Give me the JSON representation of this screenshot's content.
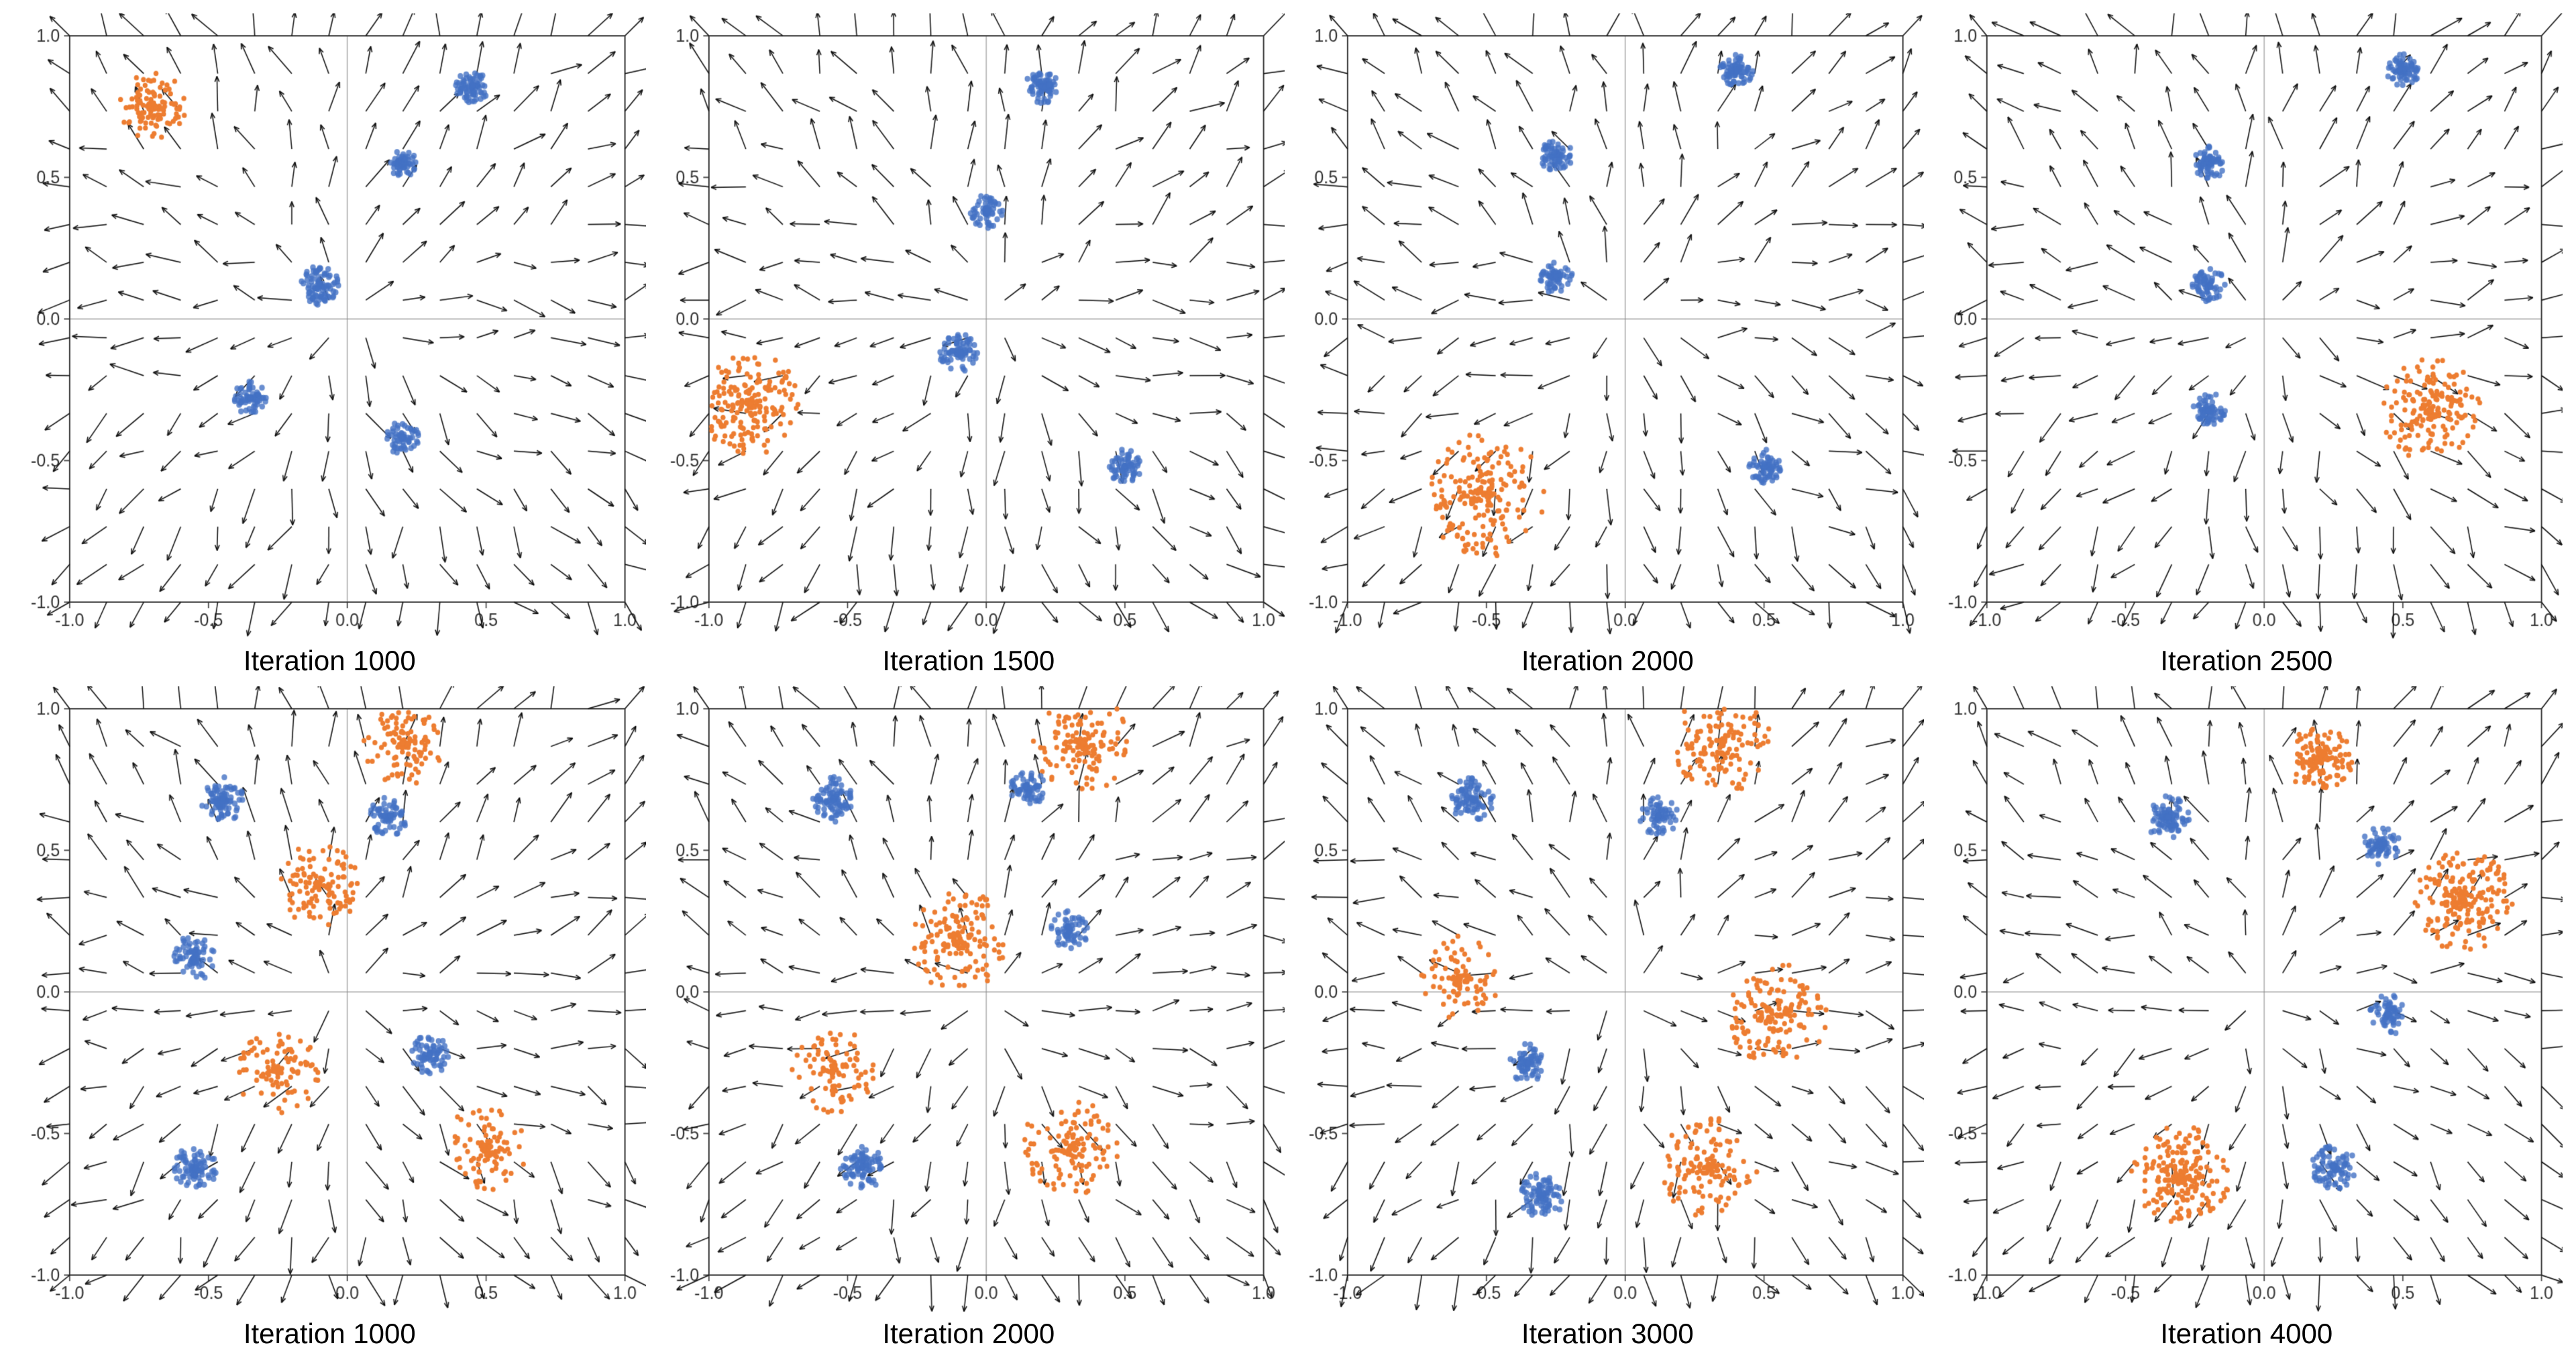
{
  "plots": [
    {
      "id": "p1",
      "title": "Iteration 1000",
      "row": 0,
      "col": 0,
      "blue_clusters": [
        {
          "cx": 0.45,
          "cy": 0.82,
          "spread": 0.06,
          "n": 80
        },
        {
          "cx": 0.2,
          "cy": 0.55,
          "spread": 0.05,
          "n": 60
        },
        {
          "cx": -0.1,
          "cy": 0.12,
          "spread": 0.07,
          "n": 90
        },
        {
          "cx": -0.35,
          "cy": -0.28,
          "spread": 0.06,
          "n": 70
        },
        {
          "cx": 0.2,
          "cy": -0.42,
          "spread": 0.06,
          "n": 65
        }
      ],
      "orange_clusters": [
        {
          "cx": -0.7,
          "cy": 0.75,
          "spread": 0.12,
          "n": 120
        }
      ],
      "has_field": true
    },
    {
      "id": "p2",
      "title": "Iteration 1500",
      "row": 0,
      "col": 1,
      "blue_clusters": [
        {
          "cx": 0.2,
          "cy": 0.82,
          "spread": 0.06,
          "n": 80
        },
        {
          "cx": -0.0,
          "cy": 0.38,
          "spread": 0.06,
          "n": 70
        },
        {
          "cx": -0.1,
          "cy": -0.12,
          "spread": 0.07,
          "n": 80
        },
        {
          "cx": 0.5,
          "cy": -0.52,
          "spread": 0.06,
          "n": 70
        }
      ],
      "orange_clusters": [
        {
          "cx": -0.85,
          "cy": -0.3,
          "spread": 0.18,
          "n": 200
        }
      ],
      "has_field": true
    },
    {
      "id": "p3",
      "title": "Iteration 2000",
      "row": 0,
      "col": 2,
      "blue_clusters": [
        {
          "cx": 0.4,
          "cy": 0.88,
          "spread": 0.06,
          "n": 80
        },
        {
          "cx": -0.25,
          "cy": 0.58,
          "spread": 0.06,
          "n": 70
        },
        {
          "cx": -0.25,
          "cy": 0.15,
          "spread": 0.06,
          "n": 70
        },
        {
          "cx": 0.5,
          "cy": -0.52,
          "spread": 0.06,
          "n": 70
        }
      ],
      "orange_clusters": [
        {
          "cx": -0.5,
          "cy": -0.62,
          "spread": 0.22,
          "n": 200
        }
      ],
      "has_field": true
    },
    {
      "id": "p4",
      "title": "Iteration 2500",
      "row": 0,
      "col": 3,
      "blue_clusters": [
        {
          "cx": 0.5,
          "cy": 0.88,
          "spread": 0.06,
          "n": 80
        },
        {
          "cx": -0.2,
          "cy": 0.55,
          "spread": 0.06,
          "n": 70
        },
        {
          "cx": -0.2,
          "cy": 0.12,
          "spread": 0.06,
          "n": 70
        },
        {
          "cx": -0.2,
          "cy": -0.32,
          "spread": 0.06,
          "n": 70
        }
      ],
      "orange_clusters": [
        {
          "cx": 0.6,
          "cy": -0.32,
          "spread": 0.18,
          "n": 180
        }
      ],
      "has_field": true
    },
    {
      "id": "p5",
      "title": "Iteration 1000",
      "row": 1,
      "col": 0,
      "blue_clusters": [
        {
          "cx": -0.45,
          "cy": 0.68,
          "spread": 0.08,
          "n": 90
        },
        {
          "cx": 0.15,
          "cy": 0.62,
          "spread": 0.07,
          "n": 70
        },
        {
          "cx": -0.55,
          "cy": 0.12,
          "spread": 0.08,
          "n": 80
        },
        {
          "cx": -0.55,
          "cy": -0.62,
          "spread": 0.08,
          "n": 90
        },
        {
          "cx": 0.3,
          "cy": -0.22,
          "spread": 0.07,
          "n": 70
        }
      ],
      "orange_clusters": [
        {
          "cx": 0.2,
          "cy": 0.88,
          "spread": 0.15,
          "n": 120
        },
        {
          "cx": -0.1,
          "cy": 0.38,
          "spread": 0.15,
          "n": 120
        },
        {
          "cx": 0.5,
          "cy": -0.55,
          "spread": 0.15,
          "n": 100
        },
        {
          "cx": -0.25,
          "cy": -0.28,
          "spread": 0.15,
          "n": 100
        }
      ],
      "has_field": true
    },
    {
      "id": "p6",
      "title": "Iteration 2000",
      "row": 1,
      "col": 1,
      "blue_clusters": [
        {
          "cx": -0.55,
          "cy": 0.68,
          "spread": 0.08,
          "n": 90
        },
        {
          "cx": 0.15,
          "cy": 0.72,
          "spread": 0.07,
          "n": 70
        },
        {
          "cx": 0.3,
          "cy": 0.22,
          "spread": 0.07,
          "n": 70
        },
        {
          "cx": -0.45,
          "cy": -0.62,
          "spread": 0.08,
          "n": 90
        }
      ],
      "orange_clusters": [
        {
          "cx": 0.35,
          "cy": 0.88,
          "spread": 0.18,
          "n": 150
        },
        {
          "cx": -0.1,
          "cy": 0.18,
          "spread": 0.18,
          "n": 150
        },
        {
          "cx": 0.3,
          "cy": -0.55,
          "spread": 0.18,
          "n": 130
        },
        {
          "cx": -0.55,
          "cy": -0.28,
          "spread": 0.15,
          "n": 100
        }
      ],
      "has_field": true
    },
    {
      "id": "p7",
      "title": "Iteration 3000",
      "row": 1,
      "col": 2,
      "blue_clusters": [
        {
          "cx": -0.55,
          "cy": 0.68,
          "spread": 0.08,
          "n": 90
        },
        {
          "cx": 0.12,
          "cy": 0.62,
          "spread": 0.07,
          "n": 70
        },
        {
          "cx": -0.35,
          "cy": -0.25,
          "spread": 0.07,
          "n": 70
        },
        {
          "cx": -0.3,
          "cy": -0.72,
          "spread": 0.08,
          "n": 90
        }
      ],
      "orange_clusters": [
        {
          "cx": 0.35,
          "cy": 0.88,
          "spread": 0.18,
          "n": 150
        },
        {
          "cx": 0.55,
          "cy": -0.08,
          "spread": 0.18,
          "n": 150
        },
        {
          "cx": 0.3,
          "cy": -0.62,
          "spread": 0.18,
          "n": 130
        },
        {
          "cx": -0.6,
          "cy": 0.05,
          "spread": 0.15,
          "n": 100
        }
      ],
      "has_field": true
    },
    {
      "id": "p8",
      "title": "Iteration 4000",
      "row": 1,
      "col": 3,
      "blue_clusters": [
        {
          "cx": -0.35,
          "cy": 0.62,
          "spread": 0.08,
          "n": 90
        },
        {
          "cx": 0.42,
          "cy": 0.52,
          "spread": 0.07,
          "n": 70
        },
        {
          "cx": 0.45,
          "cy": -0.08,
          "spread": 0.07,
          "n": 70
        },
        {
          "cx": 0.25,
          "cy": -0.62,
          "spread": 0.08,
          "n": 90
        }
      ],
      "orange_clusters": [
        {
          "cx": 0.2,
          "cy": 0.82,
          "spread": 0.12,
          "n": 150
        },
        {
          "cx": 0.72,
          "cy": 0.32,
          "spread": 0.18,
          "n": 200
        },
        {
          "cx": -0.3,
          "cy": -0.65,
          "spread": 0.18,
          "n": 200
        }
      ],
      "has_field": true
    }
  ],
  "axis": {
    "min": -1.0,
    "max": 1.0,
    "ticks": [
      -1.0,
      -0.5,
      0.0,
      0.5,
      1.0
    ]
  },
  "colors": {
    "blue": "#4472C4",
    "orange": "#ED7D31",
    "arrow": "#1a1a1a",
    "axis": "#aaaaaa",
    "background": "#ffffff"
  }
}
